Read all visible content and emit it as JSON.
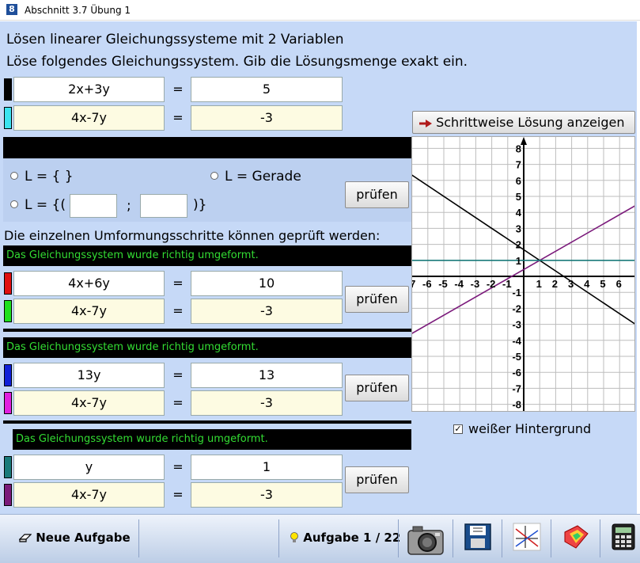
{
  "window": {
    "title": "Abschnitt 3.7   Übung 1"
  },
  "header": {
    "line1": "Lösen linearer Gleichungssysteme mit 2 Variablen",
    "line2": "Löse folgendes Gleichungssystem. Gib die Lösungsmenge exakt ein."
  },
  "colors": {
    "eq1": "#000000",
    "eq2": "#3ce4f0",
    "step1a": "#e01010",
    "step1b": "#1ee01e",
    "step2a": "#1020d8",
    "step2b": "#e020e0",
    "step3a": "#1a7a7a",
    "step3b": "#7a1a7a",
    "background": "#c6d9f7",
    "message": "#33dd33"
  },
  "system": {
    "eq1": {
      "left": "2x+3y",
      "sign": "=",
      "right": "5"
    },
    "eq2": {
      "left": "4x-7y",
      "sign": "=",
      "right": "-3"
    }
  },
  "solution": {
    "empty_label": "L = { }",
    "line_label": "L = Gerade",
    "point_open": "L = {(",
    "point_sep": ";",
    "point_close": ")}",
    "x_value": "",
    "y_value": "",
    "check_label": "prüfen"
  },
  "steps_intro": "Die einzelnen Umformungsschritte können geprüft werden:",
  "steps": [
    {
      "message": "Das Gleichungssystem wurde richtig umgeformt.",
      "eq1": {
        "left": "4x+6y",
        "sign": "=",
        "right": "10"
      },
      "eq2": {
        "left": "4x-7y",
        "sign": "=",
        "right": "-3"
      },
      "check_label": "prüfen"
    },
    {
      "message": "Das Gleichungssystem wurde richtig umgeformt.",
      "eq1": {
        "left": "13y",
        "sign": "=",
        "right": "13"
      },
      "eq2": {
        "left": "4x-7y",
        "sign": "=",
        "right": "-3"
      },
      "check_label": "prüfen"
    },
    {
      "message": "Das Gleichungssystem wurde richtig umgeformt.",
      "eq1": {
        "left": "y",
        "sign": "=",
        "right": "1"
      },
      "eq2": {
        "left": "4x-7y",
        "sign": "=",
        "right": "-3"
      },
      "check_label": "prüfen"
    }
  ],
  "stepwise_button": "Schrittweise Lösung anzeigen",
  "white_background": {
    "label": "weißer Hintergrund",
    "checked": true,
    "mark": "✓"
  },
  "footer": {
    "new_task": "Neue Aufgabe",
    "task_counter": "Aufgabe 1 / 22"
  },
  "chart_data": {
    "type": "line",
    "xlim": [
      -7,
      7
    ],
    "ylim": [
      -8.5,
      8.5
    ],
    "grid": true,
    "x_ticks": [
      "-7",
      "-6",
      "-5",
      "-4",
      "-3",
      "-2",
      "-1",
      "1",
      "2",
      "3",
      "4",
      "5",
      "6"
    ],
    "y_ticks": [
      "8",
      "7",
      "6",
      "5",
      "4",
      "3",
      "2",
      "1",
      "-1",
      "-2",
      "-3",
      "-4",
      "-5",
      "-6",
      "-7",
      "-8"
    ],
    "series": [
      {
        "equation": "2x+3y=5",
        "color": "#000000",
        "x": [
          -7,
          7
        ],
        "y": [
          6.3333,
          -3
        ]
      },
      {
        "equation": "4x-7y=-3",
        "color": "#7b1a7b",
        "x": [
          -7,
          7
        ],
        "y": [
          -3.5714,
          4.4286
        ]
      },
      {
        "equation": "y=1",
        "color": "#1a7a7a",
        "x": [
          -7,
          7
        ],
        "y": [
          1,
          1
        ]
      }
    ]
  }
}
